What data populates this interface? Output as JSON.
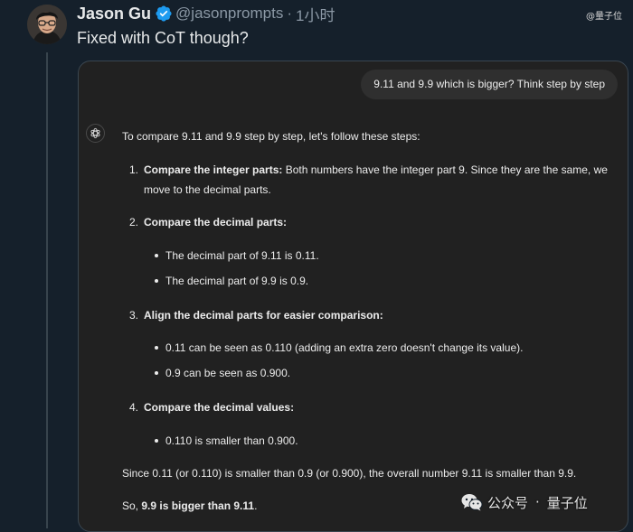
{
  "tweet": {
    "author_name": "Jason Gu",
    "handle": "@jasonprompts",
    "separator": "·",
    "time": "1小时",
    "text": "Fixed with CoT though?"
  },
  "watermark_top": "@量子位",
  "chat": {
    "user_message": "9.11 and 9.9 which is bigger? Think step by step",
    "assistant": {
      "intro": "To compare 9.11 and 9.9 step by step, let's follow these steps:",
      "steps": [
        {
          "number": "1.",
          "title": "Compare the integer parts:",
          "text_line1": "Both numbers have the integer part 9. Since they are the same, we",
          "text_line2": "move to the decimal parts."
        },
        {
          "number": "2.",
          "title": "Compare the decimal parts:",
          "bullets": [
            "The decimal part of 9.11 is 0.11.",
            "The decimal part of 9.9 is 0.9."
          ]
        },
        {
          "number": "3.",
          "title": "Align the decimal parts for easier comparison:",
          "bullets": [
            "0.11 can be seen as 0.110 (adding an extra zero doesn't change its value).",
            "0.9 can be seen as 0.900."
          ]
        },
        {
          "number": "4.",
          "title": "Compare the decimal values:",
          "bullets": [
            "0.110 is smaller than 0.900."
          ]
        }
      ],
      "summary": "Since 0.11 (or 0.110) is smaller than 0.9 (or 0.900), the overall number 9.11 is smaller than 9.9.",
      "conclusion_prefix": "So, ",
      "conclusion_bold": "9.9 is bigger than 9.11",
      "conclusion_suffix": "."
    }
  },
  "watermark_bottom": {
    "account": "公众号",
    "separator": "·",
    "name": "量子位"
  },
  "colors": {
    "background": "#15202b",
    "card": "#212121",
    "bubble": "#2f2f2f",
    "verified": "#1d9bf0",
    "handle": "#8b98a5"
  },
  "icons": [
    "verified-badge-icon",
    "openai-logo-icon",
    "wechat-icon"
  ]
}
